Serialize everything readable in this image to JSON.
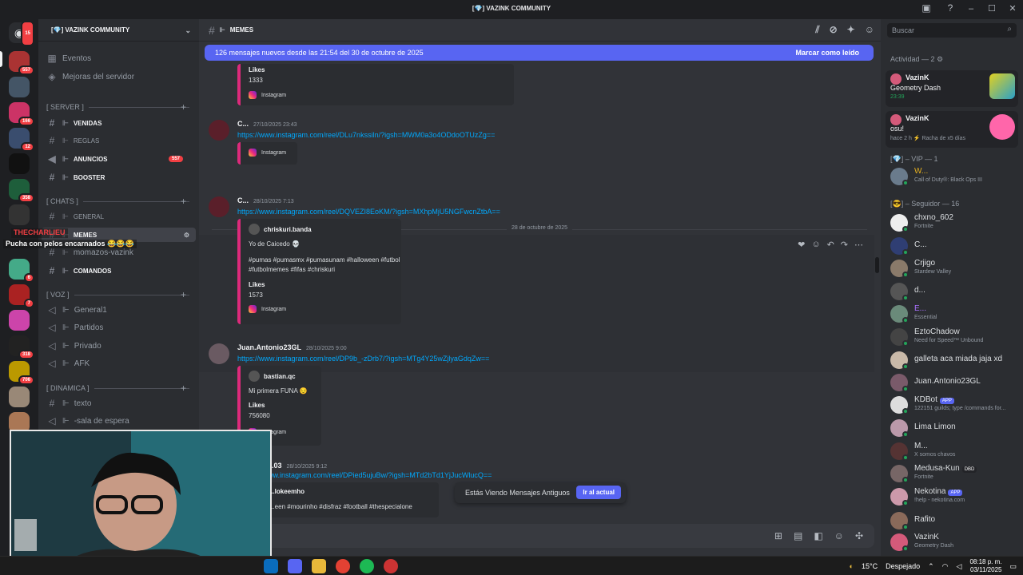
{
  "window": {
    "title": "[💎] VAZINK COMMUNITY",
    "controls": [
      "–",
      "☐",
      "✕"
    ]
  },
  "server": {
    "name": "[💎] VAZINK COMMUNITY",
    "top_items": [
      "Eventos",
      "Mejoras del servidor"
    ]
  },
  "categories": [
    {
      "name": "[ SERVER ]",
      "channels": [
        {
          "name": "VENIDAS",
          "bold": true
        },
        {
          "name": "REGLAS",
          "bold": false
        },
        {
          "name": "ANUNCIOS",
          "bold": true,
          "badge": "557"
        },
        {
          "name": "BOOSTER",
          "bold": true
        }
      ]
    },
    {
      "name": "[ CHATS ]",
      "channels": [
        {
          "name": "GENERAL",
          "bold": false
        },
        {
          "name": "MEMES",
          "bold": true
        },
        {
          "name": "momazos-vazink",
          "bold": false
        },
        {
          "name": "COMANDOS",
          "bold": true
        }
      ]
    },
    {
      "name": "[ VOZ ]",
      "channels": [
        {
          "name": "General1"
        },
        {
          "name": "Partidos"
        },
        {
          "name": "Privado"
        },
        {
          "name": "AFK"
        }
      ]
    },
    {
      "name": "[ DINAMICA ]",
      "channels": [
        {
          "name": "texto"
        },
        {
          "name": "-sala de espera"
        }
      ]
    }
  ],
  "guild_badges": [
    "15",
    "557",
    "166",
    "12",
    "358",
    "6",
    "7",
    "318",
    "706"
  ],
  "channel": {
    "name": "MEMES"
  },
  "new_messages": {
    "text": "126 mensajes nuevos desde las 21:54 del 30 de octubre de 2025",
    "action": "Marcar como leído"
  },
  "messages": [
    {
      "likes_label": "Likes",
      "likes": "1333",
      "footer": "Instagram"
    },
    {
      "author": "C...",
      "time": "27/10/2025 23:43",
      "link": "https://www.instagram.com/reel/DLu7nkssiln/?igsh=MWM0a3o4ODdoOTUzZg==",
      "footer": "Instagram"
    },
    {
      "date": "28 de octubre de 2025"
    },
    {
      "author": "C...",
      "time": "28/10/2025 7:13",
      "link": "https://www.instagram.com/reel/DQVEZI8EoKM/?igsh=MXhpMjU5NGFwcnZtbA==",
      "embed_author": "chriskuri.banda",
      "text": "Yo de Caicedo 💀",
      "tags": "#pumas #pumasmx #pumasunam #halloween #futbol #futbolmemes #fifas #chriskuri",
      "likes_label": "Likes",
      "likes": "1573",
      "footer": "Instagram"
    },
    {
      "author": "Juan.Antonio23GL",
      "time": "28/10/2025 9:00",
      "link": "https://www.instagram.com/reel/DP9b_-zDrb7/?igsh=MTg4Y25wZjlyaGdqZw==",
      "embed_author": "bastian.qc",
      "text": "Mi primera FUNA 😔",
      "likes_label": "Likes",
      "likes": "756080",
      "footer": "Instagram"
    },
    {
      "author": "...03",
      "time": "28/10/2025 9:12",
      "link": "...www.instagram.com/reel/DPied5ujuBw/?igsh=MTd2bTd1YjJucWlucQ==",
      "embed_author": "...lokeemho",
      "text": "...een #mourinho #disfraz #football #thespecialone"
    }
  ],
  "jump": {
    "text": "Estás Viendo Mensajes Antiguos",
    "button": "Ir al actual"
  },
  "search": {
    "placeholder": "Buscar"
  },
  "members": {
    "activity_header": "Actividad — 2",
    "activity": [
      {
        "name": "VazinK",
        "game": "Geometry Dash",
        "time": "23:39"
      },
      {
        "name": "VazinK",
        "game": "osu!",
        "time": "hace 2 h",
        "extra": "Racha de x5 días"
      }
    ],
    "vip_header": "[💎] – VIP — 1",
    "vip": [
      {
        "name": "W...",
        "status": "Call of Duty®: Black Ops III"
      }
    ],
    "seg_header": "[😎] – Seguidor — 16",
    "list": [
      {
        "name": "chxno_602",
        "status": "Fortnite"
      },
      {
        "name": "C...",
        "status": ""
      },
      {
        "name": "Crjigo",
        "status": "Stardew Valley"
      },
      {
        "name": "d...",
        "status": ""
      },
      {
        "name": "E...",
        "status": "Essential"
      },
      {
        "name": "EztoChadow",
        "status": "Need for Speed™ Unbound"
      },
      {
        "name": "galleta aca miada jaja xd",
        "status": ""
      },
      {
        "name": "Juan.Antonio23GL",
        "status": ""
      },
      {
        "name": "KDBot",
        "status": "122151 guilds; type /commands for...",
        "tag": "APP"
      },
      {
        "name": "Lima Limon",
        "status": ""
      },
      {
        "name": "M...",
        "status": "X somos chavos"
      },
      {
        "name": "Medusa-Kun",
        "status": "Fortnite",
        "tag": "DBD"
      },
      {
        "name": "Nekotina",
        "status": "!help - nekotina.com",
        "tag": "APP"
      },
      {
        "name": "Rafito",
        "status": ""
      },
      {
        "name": "VazinK",
        "status": "Geometry Dash"
      }
    ]
  },
  "overlay": {
    "user": "THECHARLIEU",
    "message": "Pucha con pelos encarnados 😂😂😂"
  },
  "taskbar": {
    "temp": "15°C",
    "weather": "Despejado",
    "time": "08:18 p. m.",
    "date": "03/11/2025"
  }
}
